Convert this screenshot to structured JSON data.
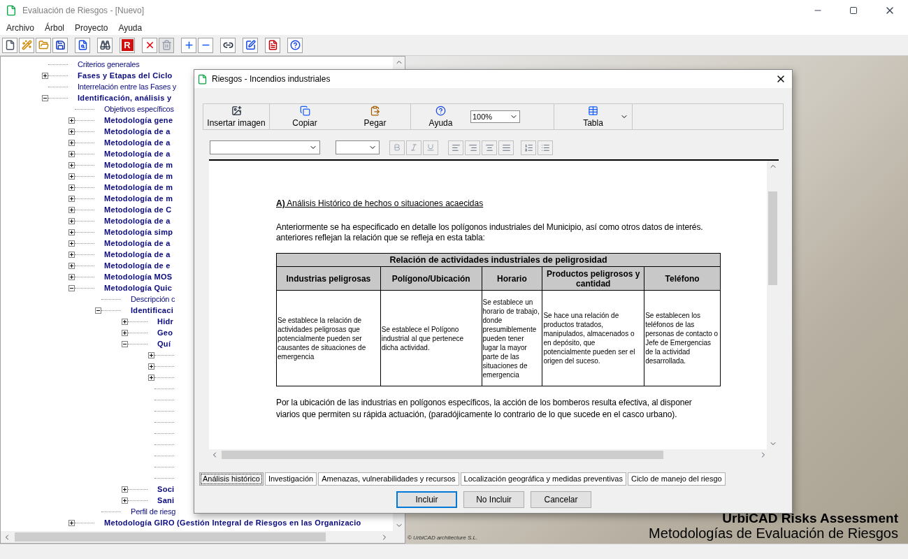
{
  "window": {
    "title": "Evaluación de Riesgos - [Nuevo]"
  },
  "menu": [
    "Archivo",
    "Árbol",
    "Proyecto",
    "Ayuda"
  ],
  "toolbar": [
    {
      "kind": "new",
      "disabled": false
    },
    {
      "kind": "wand",
      "disabled": false
    },
    {
      "kind": "open",
      "disabled": false
    },
    {
      "kind": "save",
      "disabled": false
    },
    {
      "kind": "sep"
    },
    {
      "kind": "preview",
      "disabled": false
    },
    {
      "kind": "sep"
    },
    {
      "kind": "find",
      "disabled": false
    },
    {
      "kind": "sep"
    },
    {
      "kind": "report",
      "label": "R",
      "disabled": false
    },
    {
      "kind": "sep"
    },
    {
      "kind": "delete",
      "disabled": false
    },
    {
      "kind": "trash",
      "disabled": true
    },
    {
      "kind": "sep"
    },
    {
      "kind": "add",
      "disabled": false
    },
    {
      "kind": "remove",
      "disabled": false
    },
    {
      "kind": "sep"
    },
    {
      "kind": "link",
      "disabled": false
    },
    {
      "kind": "sep"
    },
    {
      "kind": "edit",
      "disabled": false
    },
    {
      "kind": "sep"
    },
    {
      "kind": "pdf",
      "disabled": false
    },
    {
      "kind": "sep"
    },
    {
      "kind": "help",
      "disabled": false
    }
  ],
  "tree": [
    {
      "label": "Criterios generales",
      "kind": "leaf"
    },
    {
      "label": "Fases y Etapas del Ciclo",
      "kind": "branch",
      "expanded": false
    },
    {
      "label": "Interrelación entre las Fases y",
      "kind": "leaf"
    },
    {
      "label": "Identificación, análisis y",
      "kind": "branch",
      "expanded": true,
      "children": [
        {
          "label": "Objetivos específicos",
          "kind": "leaf"
        },
        {
          "label": "Metodología gene",
          "kind": "branch",
          "expanded": false
        },
        {
          "label": "Metodología de a",
          "kind": "branch",
          "expanded": false
        },
        {
          "label": "Metodología de a",
          "kind": "branch",
          "expanded": false
        },
        {
          "label": "Metodología de a",
          "kind": "branch",
          "expanded": false
        },
        {
          "label": "Metodología de m",
          "kind": "branch",
          "expanded": false
        },
        {
          "label": "Metodología de m",
          "kind": "branch",
          "expanded": false
        },
        {
          "label": "Metodología de m",
          "kind": "branch",
          "expanded": false
        },
        {
          "label": "Metodología de m",
          "kind": "branch",
          "expanded": false
        },
        {
          "label": "Metodología de C",
          "kind": "branch",
          "expanded": false
        },
        {
          "label": "Metodología de a",
          "kind": "branch",
          "expanded": false
        },
        {
          "label": "Metodología simp",
          "kind": "branch",
          "expanded": false
        },
        {
          "label": "Metodología de a",
          "kind": "branch",
          "expanded": false
        },
        {
          "label": "Metodología de a",
          "kind": "branch",
          "expanded": false
        },
        {
          "label": "Metodología de e",
          "kind": "branch",
          "expanded": false
        },
        {
          "label": "Metodología MOS",
          "kind": "branch",
          "expanded": false
        },
        {
          "label": "Metodología Quic",
          "kind": "branch",
          "expanded": true,
          "children": [
            {
              "label": "Descripción c",
              "kind": "leaf"
            },
            {
              "label": "Identificaci",
              "kind": "branch",
              "expanded": true,
              "children": [
                {
                  "label": "Hidr",
                  "kind": "branch",
                  "expanded": false
                },
                {
                  "label": "Geo",
                  "kind": "branch",
                  "expanded": false
                },
                {
                  "label": "Quí",
                  "kind": "branch",
                  "expanded": true,
                  "children": [
                    {
                      "kind": "branch",
                      "expanded": false
                    },
                    {
                      "kind": "branch",
                      "expanded": false
                    },
                    {
                      "kind": "branch",
                      "expanded": false
                    },
                    {
                      "kind": "leaf"
                    },
                    {
                      "kind": "leaf"
                    },
                    {
                      "kind": "leaf"
                    },
                    {
                      "kind": "leaf"
                    },
                    {
                      "kind": "leaf"
                    },
                    {
                      "kind": "leaf"
                    },
                    {
                      "kind": "leaf"
                    },
                    {
                      "kind": "leaf"
                    },
                    {
                      "kind": "leaf"
                    }
                  ]
                },
                {
                  "label": "Soci",
                  "kind": "branch",
                  "expanded": false
                },
                {
                  "label": "Sani",
                  "kind": "branch",
                  "expanded": false
                }
              ]
            },
            {
              "label": "Perfil de riesg",
              "kind": "leaf"
            }
          ]
        },
        {
          "label": "Metodología GIRO (Gestión Integral de Riesgos en las Organizacio",
          "kind": "branch",
          "expanded": false
        }
      ]
    }
  ],
  "splash": {
    "title": "UrbiCAD Risks Assessment",
    "subtitle": "Metodologías de Evaluación de Riesgos",
    "copyright": "© UrbiCAD architecture S.L."
  },
  "dialog": {
    "title": "Riesgos - Incendios industriales",
    "toolbar": [
      {
        "kind": "image",
        "label": "Insertar imagen"
      },
      {
        "kind": "copy",
        "label": "Copiar"
      },
      {
        "kind": "paste",
        "label": "Pegar"
      },
      {
        "kind": "help",
        "label": "Ayuda"
      }
    ],
    "zoom": "100%",
    "table_button": "Tabla",
    "document": {
      "heading": "**A)** Análisis Histórico de hechos o situaciones acaecidas",
      "paragraph_1": [
        "Anteriormente se ha especificado en detalle los polígonos industriales del Municipio, así como otros datos de interés.",
        "anteriores reflejan la relación que se refleja en esta tabla:"
      ],
      "table": {
        "title": "Relación de actividades industriales de peligrosidad",
        "columns": [
          "Industrias peligrosas",
          "Polígono/Ubicación",
          "Horario",
          "Productos peligrosos y cantidad",
          "Teléfono"
        ],
        "rows": [
          [
            "Se establece la relación de actividades peligrosas que potencialmente pueden ser causantes de situaciones de emergencia",
            "Se establece el Polígono industrial al que pertenece dicha actividad.",
            "Se establece un horario de trabajo, donde presumiblemente pueden tener lugar la mayor parte de las situaciones de emergencia",
            "Se hace una relación de productos tratados, manipulados, almacenados o en depósito, que potencialmente pueden ser el origen del suceso.",
            "Se establecen los teléfonos de las personas de contacto o Jefe de Emergencias de la actividad desarrollada."
          ]
        ]
      },
      "paragraph_2": [
        "Por la ubicación de las industrias en polígonos específicos, la acción de los bomberos resulta efectiva, al disponer",
        "viarios que permiten su rápida actuación, (paradójicamente lo contrario de lo que sucede en el casco urbano)."
      ]
    },
    "tabs": [
      {
        "label": "Análisis histórico",
        "selected": true
      },
      {
        "label": "Investigación",
        "selected": false
      },
      {
        "label": "Amenazas, vulnerabilidades y recursos",
        "selected": false
      },
      {
        "label": "Localización geográfica y medidas preventivas",
        "selected": false
      },
      {
        "label": "Ciclo de manejo del riesgo",
        "selected": false
      }
    ],
    "buttons": [
      "Incluir",
      "No Incluir",
      "Cancelar"
    ]
  }
}
